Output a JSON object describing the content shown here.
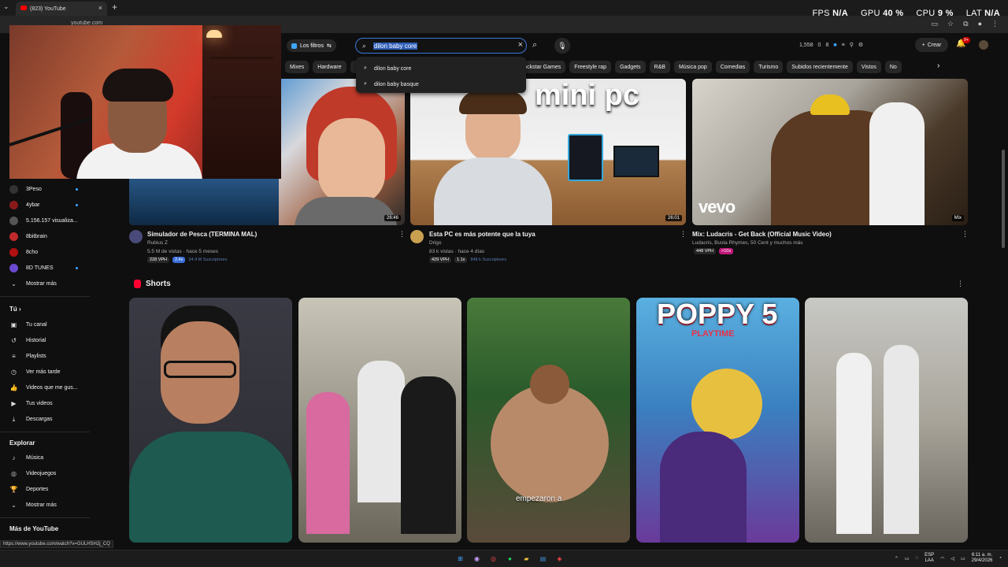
{
  "browser": {
    "tab_title": "(823) YouTube",
    "address": "youtube.com",
    "status_url": "https://www.youtube.com/watch?v=GULHSH2j_CQ"
  },
  "perf": {
    "fps_label": "FPS",
    "fps_value": "N/A",
    "gpu_label": "GPU",
    "gpu_value": "40 %",
    "cpu_label": "CPU",
    "cpu_value": "9 %",
    "lat_label": "LAT",
    "lat_value": "N/A"
  },
  "header": {
    "filters_label": "Los filtros",
    "search_value": "dilon baby core",
    "stats": [
      "1,558",
      "0",
      "8"
    ],
    "create_label": "Crear",
    "notif_badge": "9+"
  },
  "suggestions": [
    "dilon baby core",
    "dilon baby basque"
  ],
  "chips": [
    "Mixes",
    "Hardware",
    "",
    "",
    "",
    "",
    "icas",
    "Rockstar Games",
    "Freestyle rap",
    "Gadgets",
    "R&B",
    "Música pop",
    "Comedias",
    "Turismo",
    "Subidos recientemente",
    "Vistos",
    "No"
  ],
  "sidebar": {
    "subscriptions": [
      {
        "name": "3Peso",
        "color": "#333333"
      },
      {
        "name": "4ybar",
        "color": "#8a1a1a"
      },
      {
        "name": "5.156.157 visualiza...",
        "color": "#555555"
      },
      {
        "name": "8bitbrain",
        "color": "#c02a2a"
      },
      {
        "name": "8cho",
        "color": "#b01010"
      },
      {
        "name": "8D TUNES",
        "color": "#6a4ad0"
      }
    ],
    "show_more": "Mostrar más",
    "you_header": "Tú",
    "you_items": [
      "Tu canal",
      "Historial",
      "Playlists",
      "Ver más tarde",
      "Videos que me gus...",
      "Tus videos",
      "Descargas"
    ],
    "explore_header": "Explorar",
    "explore_items": [
      "Música",
      "Videojuegos",
      "Deportes",
      "Mostrar más"
    ],
    "more_header": "Más de YouTube"
  },
  "videos": [
    {
      "title": "Simulador de Pesca (TERMINA MAL)",
      "channel": "Rubius Z",
      "meta": "5.5 M de vistas · hace 5 meses",
      "duration": "26:46",
      "stat1": "228 VPH",
      "stat2": "2.4x",
      "stat3": "34.4 M Suscriptores"
    },
    {
      "title": "Esta PC es más potente que la tuya",
      "channel": "Drigo",
      "meta": "83 k vistas · hace 4 días",
      "duration": "26:01",
      "overlay_text": "mini pc",
      "stat1": "429 VPH",
      "stat2": "1.1x",
      "stat3": "848 k Suscriptores"
    },
    {
      "title": "Mix: Ludacris - Get Back (Official Music Video)",
      "channel": "Ludacris, Busta Rhymes, 50 Cent y muchos más",
      "meta": "",
      "duration": "Mix",
      "logo_text": "vevo",
      "stat1": "448 VPH",
      "stat2": ">10x"
    }
  ],
  "shorts": {
    "header": "Shorts",
    "overlay_text_3": "empezaron a",
    "poppy_text": "POPPY 5",
    "poppy_sub": "PLAYTIME"
  },
  "taskbar": {
    "lang": "ESP",
    "lang2": "LAA",
    "time": "6:11 a. m.",
    "date": "29/4/2026"
  }
}
